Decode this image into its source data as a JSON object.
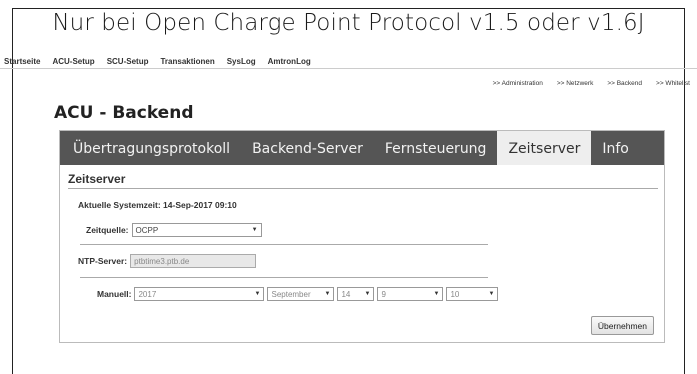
{
  "caption": "Nur bei Open Charge Point Protocol v1.5 oder v1.6J",
  "topnav": [
    "Startseite",
    "ACU-Setup",
    "SCU-Setup",
    "Transaktionen",
    "SysLog",
    "AmtronLog"
  ],
  "subnav": [
    ">> Administration",
    ">> Netzwerk",
    ">> Backend",
    ">> Whitelist"
  ],
  "page_title": "ACU - Backend",
  "tabs": [
    {
      "label": "Übertragungsprotokoll",
      "active": false
    },
    {
      "label": "Backend-Server",
      "active": false
    },
    {
      "label": "Fernsteuerung",
      "active": false
    },
    {
      "label": "Zeitserver",
      "active": true
    },
    {
      "label": "Info",
      "active": false
    }
  ],
  "section": {
    "title": "Zeitserver",
    "system_time": "Aktuelle Systemzeit: 14-Sep-2017 09:10",
    "time_source": {
      "label": "Zeitquelle:",
      "value": "OCPP"
    },
    "ntp_server": {
      "label": "NTP-Server:",
      "value": "ptbtime3.ptb.de"
    },
    "manual": {
      "label": "Manuell:",
      "year": "2017",
      "month": "September",
      "day": "14",
      "hour": "9",
      "minute": "10"
    },
    "apply_button": "Übernehmen"
  }
}
